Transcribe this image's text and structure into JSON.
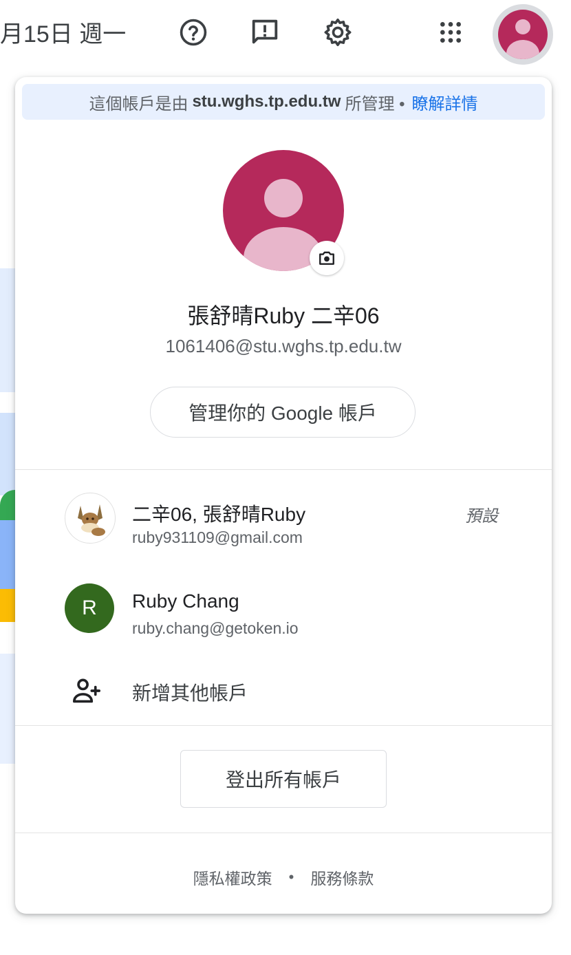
{
  "topbar": {
    "date_text": "月15日 週一",
    "icons": [
      "help-icon",
      "feedback-icon",
      "settings-icon",
      "apps-icon"
    ],
    "avatar_color": "#b5295b"
  },
  "popup": {
    "banner": {
      "prefix": "這個帳戶是由",
      "domain": "stu.wghs.tp.edu.tw",
      "suffix": "所管理 •",
      "link": "瞭解詳情"
    },
    "profile": {
      "name": "張舒晴Ruby 二辛06",
      "email": "1061406@stu.wghs.tp.edu.tw",
      "manage_button": "管理你的 Google 帳戶"
    },
    "accounts": [
      {
        "name": "二辛06, 張舒晴Ruby",
        "email": "ruby931109@gmail.com",
        "tag": "預設",
        "avatar": "eevee-avatar"
      },
      {
        "name": "Ruby Chang",
        "email": "ruby.chang@getoken.io",
        "initial": "R",
        "avatar_color": "#33691e"
      }
    ],
    "add_account": "新增其他帳戶",
    "sign_out_all": "登出所有帳戶",
    "footer": {
      "privacy": "隱私權政策",
      "separator": "•",
      "terms": "服務條款"
    }
  },
  "colors": {
    "accent": "#1a73e8",
    "banner_bg": "#e8f0fe",
    "text_primary": "#202124",
    "text_secondary": "#5f6368"
  }
}
